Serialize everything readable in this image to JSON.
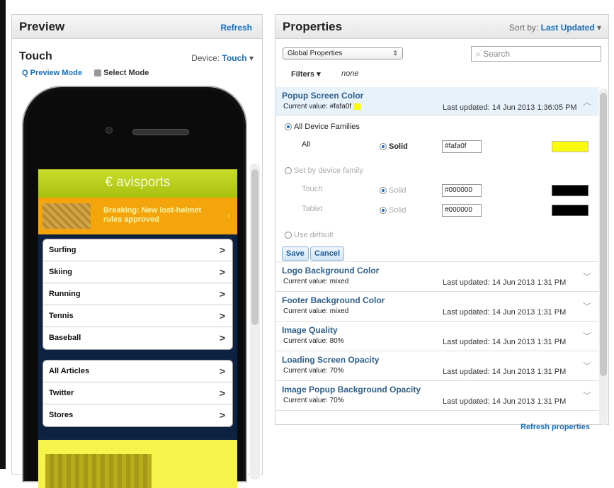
{
  "preview": {
    "title": "Preview",
    "refresh": "Refresh",
    "device_heading": "Touch",
    "device_label": "Device:",
    "device_value": "Touch",
    "preview_mode": "Preview Mode",
    "select_mode": "Select Mode"
  },
  "phone": {
    "logo": "avisports",
    "breaking": "Breaking: New lost-helmet rules approved",
    "menu1": [
      "Surfing",
      "Skiing",
      "Running",
      "Tennis",
      "Baseball"
    ],
    "menu2": [
      "All Articles",
      "Twitter",
      "Stores"
    ],
    "chevron": ">"
  },
  "properties": {
    "title": "Properties",
    "sort_label": "Sort by:",
    "sort_value": "Last Updated",
    "global_select": "Global Properties",
    "search_placeholder": "Search",
    "filters_label": "Filters",
    "filters_value": "none",
    "refresh_properties": "Refresh properties",
    "selected": {
      "name": "Popup Screen Color",
      "current": "Current value: #fafa0f",
      "updated": "Last updated: 14 Jun 2013 1:36:05 PM",
      "swatch_color": "#fafa0f"
    },
    "editor": {
      "all_families": "All Device Families",
      "all": "All",
      "solid": "Solid",
      "all_hex": "#fafa0f",
      "all_color": "#fafa0f",
      "by_family": "Set by device family",
      "touch": "Touch",
      "touch_hex": "#000000",
      "tablet": "Tablet",
      "tablet_hex": "#000000",
      "use_default": "Use default",
      "save": "Save",
      "cancel": "Cancel"
    },
    "items": [
      {
        "name": "Logo Background Color",
        "current": "Current value: mixed",
        "updated": "Last updated: 14 Jun 2013 1:31 PM"
      },
      {
        "name": "Footer Background Color",
        "current": "Current value: mixed",
        "updated": "Last updated: 14 Jun 2013 1:31 PM"
      },
      {
        "name": "Image Quality",
        "current": "Current value: 80%",
        "updated": "Last updated: 14 Jun 2013 1:31 PM"
      },
      {
        "name": "Loading Screen Opacity",
        "current": "Current value: 70%",
        "updated": "Last updated: 14 Jun 2013 1:31 PM"
      },
      {
        "name": "Image Popup Background Opacity",
        "current": "Current value: 70%",
        "updated": "Last updated: 14 Jun 2013 1:31 PM"
      }
    ]
  }
}
